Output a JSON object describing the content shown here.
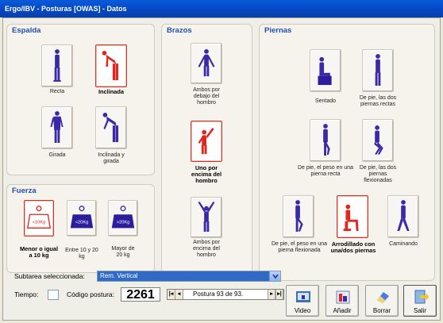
{
  "window": {
    "title": "Ergo/IBV - Posturas [OWAS] - Datos"
  },
  "espalda": {
    "title": "Espalda",
    "items": [
      {
        "label": "Recta",
        "selected": false,
        "icon": "standing-upright-icon"
      },
      {
        "label": "Inclinada",
        "selected": true,
        "icon": "bent-forward-icon"
      },
      {
        "label": "Girada",
        "selected": false,
        "icon": "twisted-torso-icon"
      },
      {
        "label": "Inclinada y girada",
        "selected": false,
        "icon": "bent-twisted-icon"
      }
    ]
  },
  "fuerza": {
    "title": "Fuerza",
    "items": [
      {
        "label": "Menor o igual a 10 kg",
        "weight": "<10Kg",
        "selected": true
      },
      {
        "label": "Entre 10 y 20 kg",
        "weight": "<20Kg",
        "selected": false
      },
      {
        "label": "Mayor de 20 kg",
        "weight": ">20Kg",
        "selected": false
      }
    ]
  },
  "brazos": {
    "title": "Brazos",
    "items": [
      {
        "label": "Ambos por debajo del hombro",
        "selected": false
      },
      {
        "label": "Uno por encima del hombro",
        "selected": true
      },
      {
        "label": "Ambos por encima del hombro",
        "selected": false
      }
    ]
  },
  "piernas": {
    "title": "Piernas",
    "items": [
      {
        "label": "Sentado",
        "selected": false
      },
      {
        "label": "De pie, las dos piernas rectas",
        "selected": false
      },
      {
        "label": "De pie, el peso en una pierna recta",
        "selected": false
      },
      {
        "label": "De pie, las dos piernas flexionadas",
        "selected": false
      },
      {
        "label": "De pie, el peso en una pierna flexionada",
        "selected": false
      },
      {
        "label": "Arrodillado con una/dos piernas",
        "selected": true
      },
      {
        "label": "Caminando",
        "selected": false
      }
    ]
  },
  "subtarea": {
    "label": "Subtarea seleccionada:",
    "value": "Rem. Vertical"
  },
  "tiempo": {
    "label": "Tiempo:"
  },
  "codigo": {
    "label": "Código postura:",
    "value": "2261"
  },
  "navigator": {
    "text": "Postura 93 de 93."
  },
  "buttons": {
    "video": "Video",
    "anadir": "Añadir",
    "borrar": "Borrar",
    "salir": "Salir"
  },
  "colors": {
    "titlebar": "#0a5bd8",
    "panel_title": "#1f4fb0",
    "figure_blue": "#3a2aa8",
    "figure_selected": "#e0261e"
  }
}
